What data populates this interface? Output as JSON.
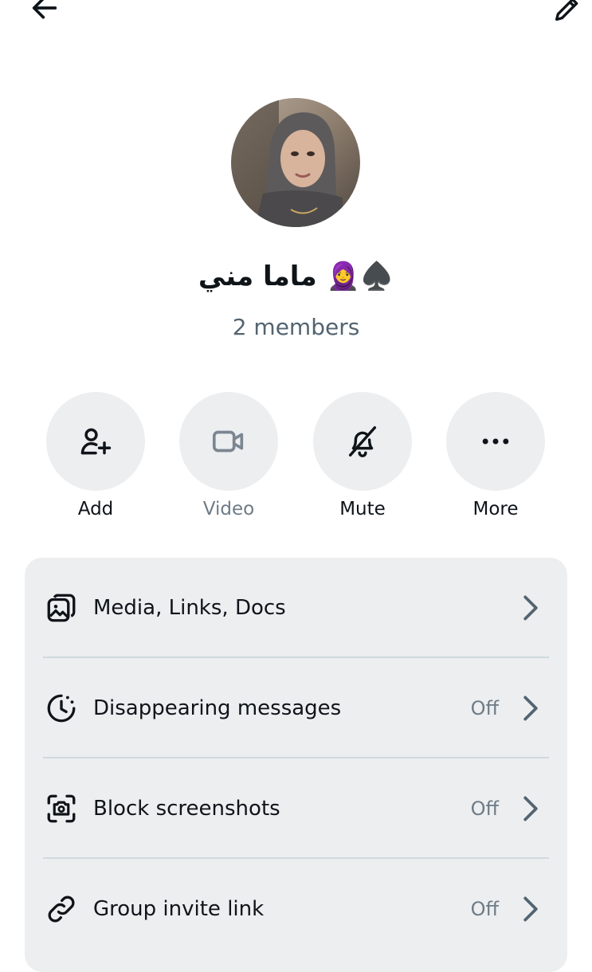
{
  "header": {
    "back_icon": "arrow-left-icon",
    "edit_icon": "pencil-icon"
  },
  "group": {
    "name": "ماما مني 🧕♠️",
    "members": "2 members"
  },
  "actions": [
    {
      "label": "Add",
      "icon": "add-person-icon"
    },
    {
      "label": "Video",
      "icon": "video-camera-icon"
    },
    {
      "label": "Mute",
      "icon": "bell-off-icon"
    },
    {
      "label": "More",
      "icon": "more-dots-icon"
    }
  ],
  "settings": [
    {
      "label": "Media, Links, Docs",
      "status": "",
      "icon": "media-icon"
    },
    {
      "label": "Disappearing messages",
      "status": "Off",
      "icon": "timer-icon"
    },
    {
      "label": "Block screenshots",
      "status": "Off",
      "icon": "screenshot-block-icon"
    },
    {
      "label": "Group invite link",
      "status": "Off",
      "icon": "link-icon"
    }
  ],
  "colors": {
    "text": "#0f1419",
    "secondary": "#536471",
    "surface": "#eceef0"
  }
}
